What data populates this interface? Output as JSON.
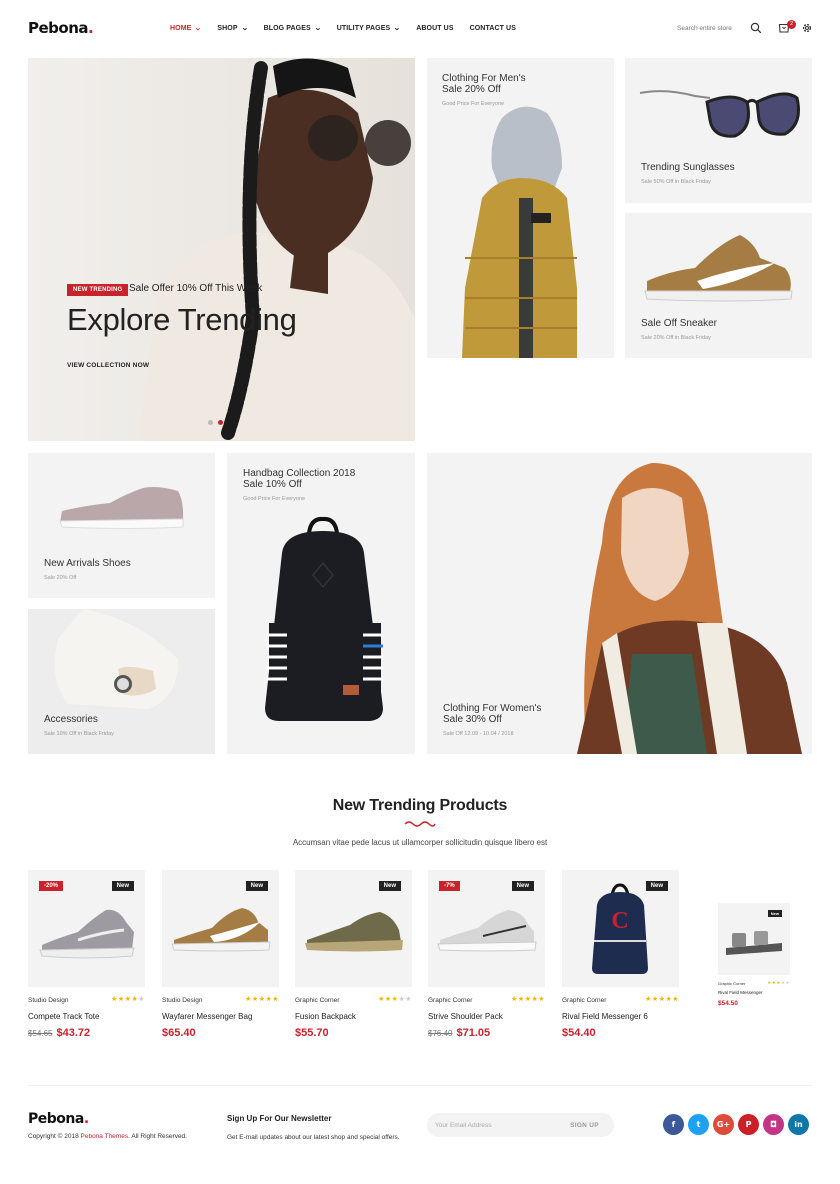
{
  "brand": {
    "name": "Pebona",
    "dot": ".",
    "accent": "#c8232c"
  },
  "nav": [
    {
      "label": "HOME",
      "dropdown": true,
      "active": true
    },
    {
      "label": "SHOP",
      "dropdown": true
    },
    {
      "label": "BLOG PAGES",
      "dropdown": true
    },
    {
      "label": "UTILITY PAGES",
      "dropdown": true
    },
    {
      "label": "ABOUT US",
      "dropdown": false
    },
    {
      "label": "CONTACT US",
      "dropdown": false
    }
  ],
  "header": {
    "search_text": "Search entire store",
    "cart_count": "2",
    "icons": [
      "search-icon",
      "cart-icon",
      "settings-icon"
    ]
  },
  "hero": {
    "badge": "NEW TRENDING",
    "offer": "Sale Offer 10% Off This Week",
    "title": "Explore Trending",
    "cta": "VIEW COLLECTION NOW"
  },
  "banners": {
    "mens": {
      "title1": "Clothing For Men's",
      "title2": "Sale 20% Off",
      "sub": "Good Price For Everyone"
    },
    "sunglasses": {
      "title": "Trending Sunglasses",
      "sub": "Sale 50% Off in Black Friday"
    },
    "sneaker": {
      "title": "Sale Off Sneaker",
      "sub": "Sale 20% Off in Black Friday"
    },
    "shoes": {
      "title": "New Arrivals Shoes",
      "sub": "Sale 20% Off"
    },
    "accessories": {
      "title": "Accessories",
      "sub": "Sale 10% Off in Black Friday"
    },
    "handbag": {
      "title1": "Handbag Collection 2018",
      "title2": "Sale 10% Off",
      "sub": "Good Price For Everyone"
    },
    "womens": {
      "title1": "Clothing For Women's",
      "title2": "Sale 30% Off",
      "sub": "Sale Off 12.09 - 10.04 / 2018"
    }
  },
  "section": {
    "title": "New Trending Products",
    "desc": "Accumsan vitae pede lacus ut ullamcorper sollicitudin quisque libero est"
  },
  "products": [
    {
      "brand": "Studio Design",
      "name": "Compete Track Tote",
      "old_price": "$54.65",
      "price": "$43.72",
      "sale_tag": "-20%",
      "new_tag": "New",
      "rating": 4
    },
    {
      "brand": "Studio Design",
      "name": "Wayfarer Messenger Bag",
      "old_price": "",
      "price": "$65.40",
      "sale_tag": "",
      "new_tag": "New",
      "rating": 5
    },
    {
      "brand": "Graphic Corner",
      "name": "Fusion Backpack",
      "old_price": "",
      "price": "$55.70",
      "sale_tag": "",
      "new_tag": "New",
      "rating": 3
    },
    {
      "brand": "Graphic Corner",
      "name": "Strive Shoulder Pack",
      "old_price": "$76.40",
      "price": "$71.05",
      "sale_tag": "-7%",
      "new_tag": "New",
      "rating": 5
    },
    {
      "brand": "Graphic Corner",
      "name": "Rival Field Messenger 6",
      "old_price": "",
      "price": "$54.40",
      "sale_tag": "",
      "new_tag": "New",
      "rating": 5
    },
    {
      "brand": "Graphic Corner",
      "name": "Rival Field Messenger",
      "old_price": "",
      "price": "$54.50",
      "sale_tag": "",
      "new_tag": "New",
      "rating": 3
    }
  ],
  "footer": {
    "copyright_pre": "Copyright © 2018",
    "copyright_brand": "Pebona Themes",
    "copyright_post": ". All Right Reserved.",
    "newsletter_title": "Sign Up For Our Newsletter",
    "newsletter_desc": "Get E-mail updates about our latest shop and special offers.",
    "email_placeholder": "Your Email Address",
    "signup_label": "SIGN UP",
    "socials": [
      {
        "icon": "facebook-icon",
        "glyph": "f",
        "color": "#3b5998"
      },
      {
        "icon": "twitter-icon",
        "glyph": "t",
        "color": "#1da1f2"
      },
      {
        "icon": "google-plus-icon",
        "glyph": "G+",
        "color": "#dd4b39"
      },
      {
        "icon": "pinterest-icon",
        "glyph": "P",
        "color": "#cb2027"
      },
      {
        "icon": "instagram-icon",
        "glyph": "◘",
        "color": "#c13584"
      },
      {
        "icon": "linkedin-icon",
        "glyph": "in",
        "color": "#0e76a8"
      }
    ]
  }
}
